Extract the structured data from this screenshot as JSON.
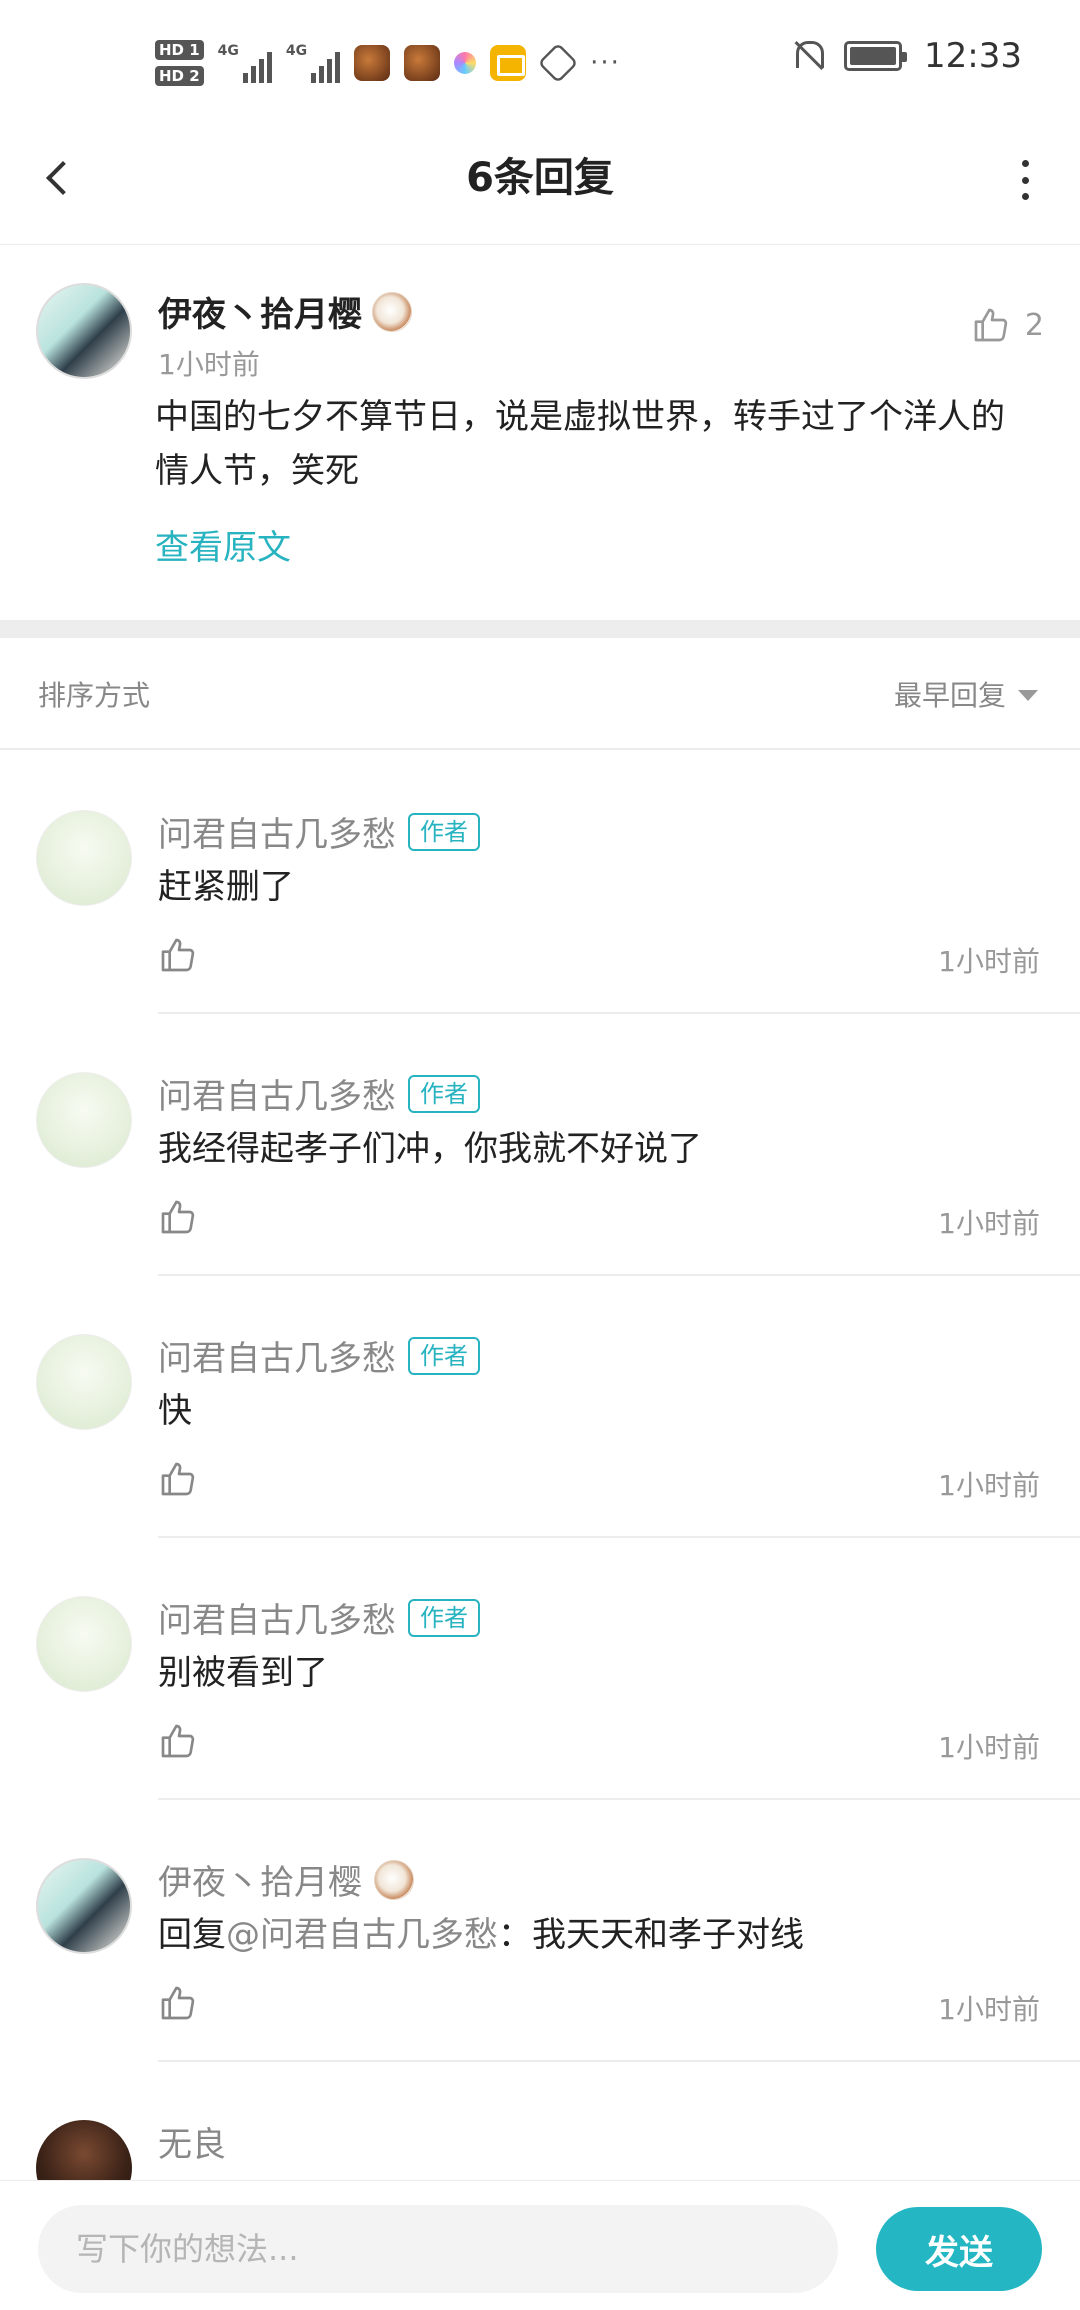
{
  "status_bar": {
    "hd1": "HD 1",
    "hd2": "HD 2",
    "sig1": "4G",
    "sig2": "4G",
    "more": "···",
    "time": "12:33"
  },
  "header": {
    "title": "6条回复"
  },
  "post": {
    "author": "伊夜丶拾月樱",
    "time": "1小时前",
    "likes": "2",
    "body": "中国的七夕不算节日，说是虚拟世界，转手过了个洋人的情人节，笑死",
    "view_original": "查看原文"
  },
  "sort": {
    "label": "排序方式",
    "value": "最早回复"
  },
  "replies": [
    {
      "author": "问君自古几多愁",
      "tag": "作者",
      "text": "赶紧删了",
      "time": "1小时前"
    },
    {
      "author": "问君自古几多愁",
      "tag": "作者",
      "text": "我经得起孝子们冲，你我就不好说了",
      "time": "1小时前"
    },
    {
      "author": "问君自古几多愁",
      "tag": "作者",
      "text": "快",
      "time": "1小时前"
    },
    {
      "author": "问君自古几多愁",
      "tag": "作者",
      "text": "别被看到了",
      "time": "1小时前"
    },
    {
      "author": "伊夜丶拾月樱",
      "reply_prefix": "回复",
      "mention": "@问君自古几多愁",
      "text_after": "：我天天和孝子对线",
      "time": "1小时前"
    },
    {
      "author": "无良"
    }
  ],
  "input": {
    "placeholder": "写下你的想法...",
    "send_label": "发送"
  },
  "colors": {
    "accent": "#24b7c3",
    "muted": "#888888"
  }
}
